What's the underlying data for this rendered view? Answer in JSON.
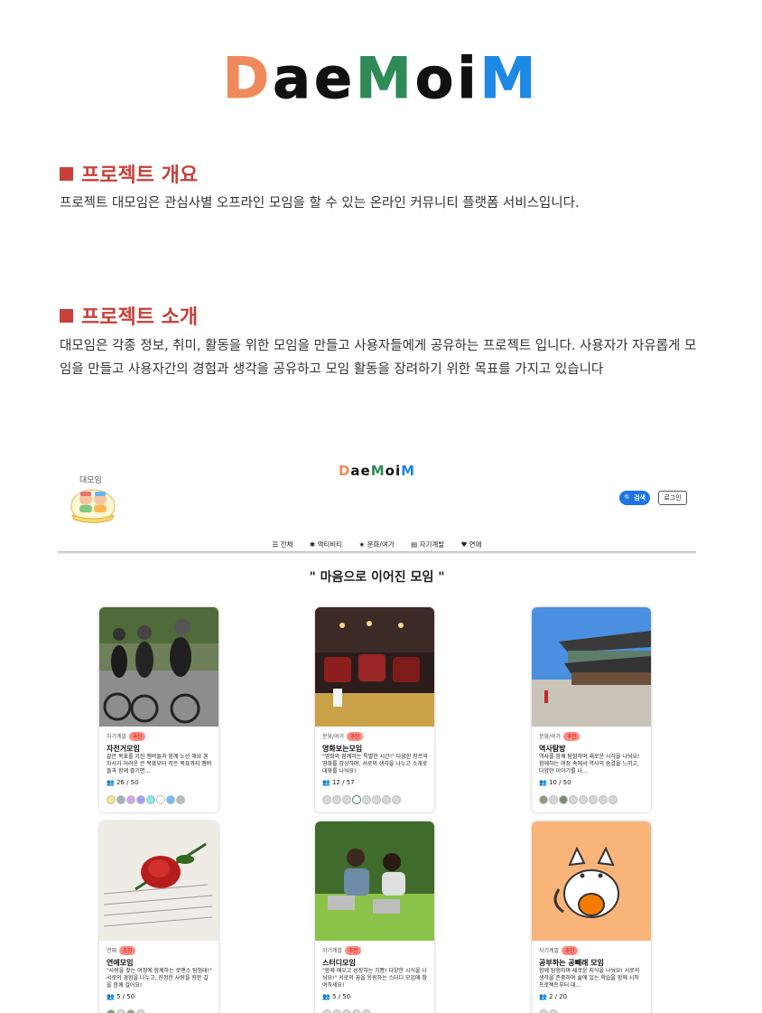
{
  "logo": {
    "letters": [
      "D",
      "a",
      "e",
      "M",
      "o",
      "i",
      "M"
    ],
    "colors": [
      "#f08a5d",
      "#111111",
      "#111111",
      "#2e8b57",
      "#111111",
      "#111111",
      "#1e88e5"
    ]
  },
  "overview": {
    "title": "프로젝트 개요",
    "text": "프로젝트 대모임은 관심사별 오프라인 모임을 할 수 있는 온라인 커뮤니티 플랫폼 서비스입니다."
  },
  "intro": {
    "title": "프로젝트 소개",
    "text": "대모임은 각종 정보, 취미, 활동을 위한 모임을 만들고 사용자들에게 공유하는 프로젝트 입니다. 사용자가 자유롭게 모임을 만들고 사용자간의 경험과 생각을 공유하고 모임 활동을 장려하기 위한 목표를 가지고 있습니다"
  },
  "screenshot": {
    "mascot_label": "대모임",
    "search_label": "🔍 검색",
    "login_label": "로그인",
    "nav": [
      "☰ 전체",
      "✱ 액티비티",
      "★ 문화/여가",
      "▤ 자기계발",
      "♥ 연애"
    ],
    "section_title": "\" 마음으로 이어진 모임 \"",
    "cards": [
      {
        "category": "자기계발",
        "badge": "추천",
        "name": "자전거모임",
        "desc": "같은 목표를 가진 멤버들과 함께 노선 해요 혼자서가 어려운 큰 목표부터 작은 목표까지 멤버들과 함께 즐기면…",
        "count": "26 / 50"
      },
      {
        "category": "문화/여가",
        "badge": "추천",
        "name": "영화보는모임",
        "desc": "\"영화와 함께하는 특별한 시간!\" 다양한 장르의 영화를 감상하며, 서로의 생각을 나누고 소개로 대화를 나눠요!",
        "count": "12 / 57"
      },
      {
        "category": "문화/여가",
        "badge": "추천",
        "name": "역사탐방",
        "desc": "역사를 함께 탐험하며 새로운 시각을 나눠요! 함께하는 여정 속에서 역사의 숨결을 느끼고, 다양한 이야기를 나…",
        "count": "10 / 50"
      },
      {
        "category": "연애",
        "badge": "추천",
        "name": "연애모임",
        "desc": "\"사랑을 찾는 여정에 함께하는 로맨스 탐험대!\" 서로의 경험을 나누고, 진정한 사랑을 향한 길을 함께 걸어요!",
        "count": "5 / 50"
      },
      {
        "category": "자기계발",
        "badge": "추천",
        "name": "스터디모임",
        "desc": "\"함께 배우고 성장하는 기쁨! 다양한 시식을 나눠요!\" 서로의 꿈을 응원하는 스터디 모임에 참여하세요!",
        "count": "5 / 50"
      },
      {
        "category": "자기계발",
        "badge": "추천",
        "name": "공부하는 공빼래 모임",
        "desc": "함께 탐험하며 새로운 지식을 나눠요! 서로의 생각을 존중하며 삶에 있는 학습을 함께 시작 프로젝트부터 대…",
        "count": "2 / 20"
      }
    ]
  }
}
